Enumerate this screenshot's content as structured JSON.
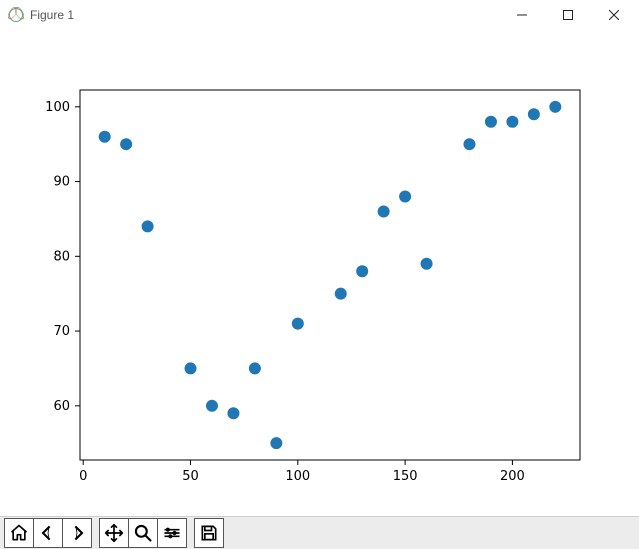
{
  "window": {
    "title": "Figure 1",
    "controls": {
      "minimize": "minimize-icon",
      "maximize": "maximize-icon",
      "close": "close-icon"
    }
  },
  "chart_data": {
    "type": "scatter",
    "x": [
      10,
      20,
      30,
      50,
      60,
      70,
      80,
      90,
      100,
      120,
      130,
      140,
      150,
      160,
      180,
      190,
      200,
      210,
      220
    ],
    "y": [
      96,
      95,
      84,
      65,
      60,
      59,
      65,
      55,
      71,
      75,
      78,
      86,
      88,
      79,
      95,
      98,
      98,
      99,
      100
    ],
    "xlabel": "",
    "ylabel": "",
    "title": "",
    "xlim": [
      -1.5,
      231.5
    ],
    "ylim": [
      52.75,
      102.25
    ],
    "xticks": [
      0,
      50,
      100,
      150,
      200
    ],
    "yticks": [
      60,
      70,
      80,
      90,
      100
    ],
    "marker_color": "#1f77b4",
    "marker_size": 6
  },
  "toolbar": {
    "buttons": [
      {
        "name": "home-button",
        "icon": "home-icon",
        "label": "Home"
      },
      {
        "name": "back-button",
        "icon": "back-icon",
        "label": "Back"
      },
      {
        "name": "forward-button",
        "icon": "forward-icon",
        "label": "Forward"
      },
      {
        "sep": true
      },
      {
        "name": "pan-button",
        "icon": "pan-icon",
        "label": "Pan"
      },
      {
        "name": "zoom-button",
        "icon": "zoom-icon",
        "label": "Zoom"
      },
      {
        "name": "subplots-button",
        "icon": "subplots-icon",
        "label": "Configure subplots"
      },
      {
        "sep": true
      },
      {
        "name": "save-button",
        "icon": "save-icon",
        "label": "Save"
      }
    ]
  }
}
